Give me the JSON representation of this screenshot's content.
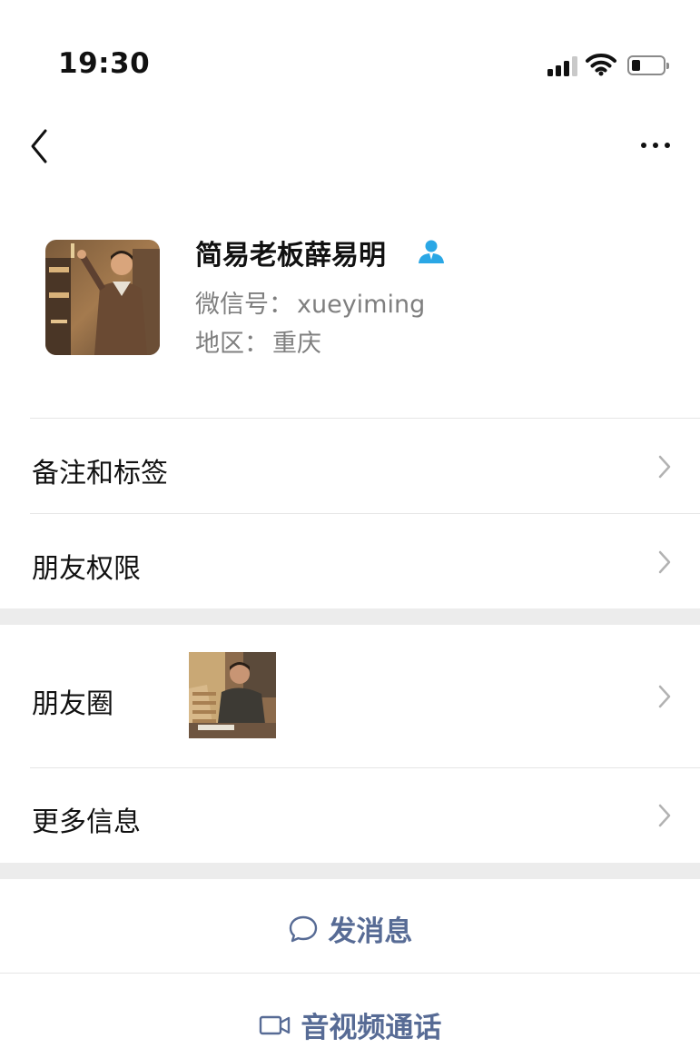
{
  "status_bar": {
    "time": "19:30",
    "icons": [
      "signal-icon",
      "wifi-icon",
      "battery-icon"
    ]
  },
  "nav": {
    "back_icon": "chevron-left-icon",
    "more_icon": "ellipsis-icon"
  },
  "profile": {
    "name": "简易老板薛易明",
    "badge_icon": "person-icon",
    "wechat_id_label": "微信号：",
    "wechat_id": "xueyiming",
    "region_label": "地区：",
    "region": "重庆"
  },
  "rows": {
    "notes_tags": "备注和标签",
    "friend_permissions": "朋友权限",
    "moments": "朋友圈",
    "more_info": "更多信息"
  },
  "actions": {
    "send_message": "发消息",
    "send_message_icon": "chat-bubble-icon",
    "video_call": "音视频通话",
    "video_call_icon": "video-camera-icon"
  },
  "colors": {
    "link_blue": "#576b95",
    "badge_blue": "#2aa7e5",
    "section_gap": "#ececec",
    "secondary_text": "#7f7f7f"
  }
}
